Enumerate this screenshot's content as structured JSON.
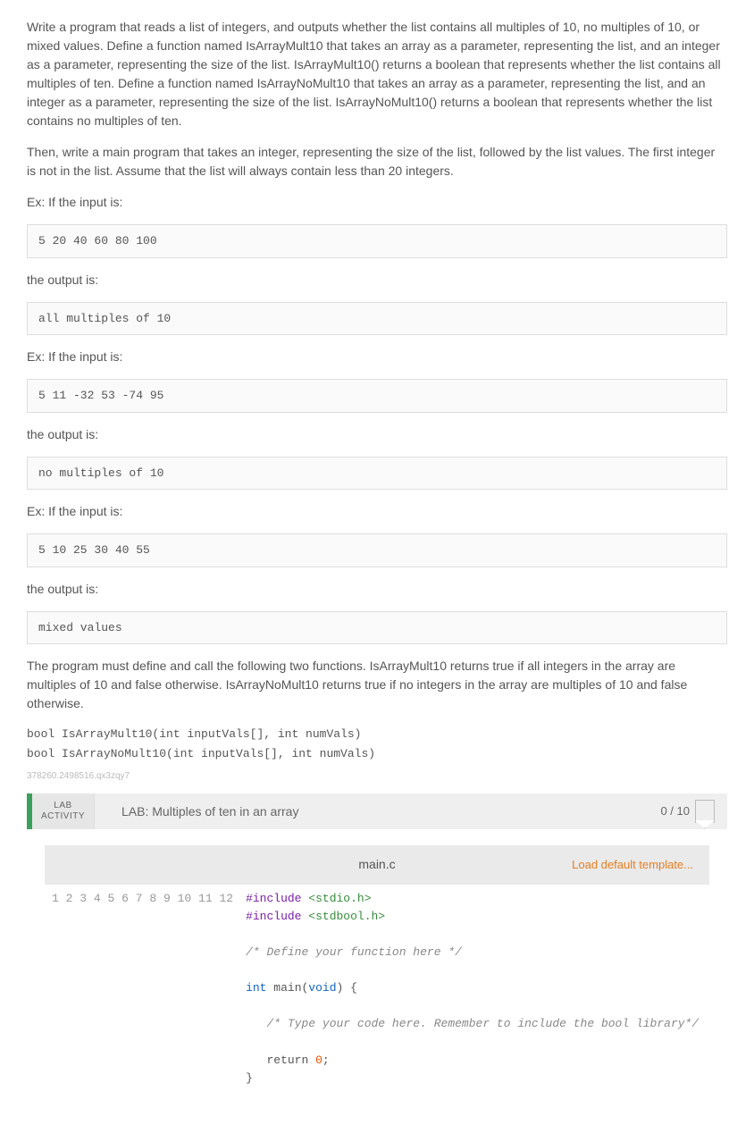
{
  "prose": {
    "p1": "Write a program that reads a list of integers, and outputs whether the list contains all multiples of 10, no multiples of 10, or mixed values. Define a function named IsArrayMult10 that takes an array as a parameter, representing the list, and an integer as a parameter, representing the size of the list. IsArrayMult10() returns a boolean that represents whether the list contains all multiples of ten. Define a function named IsArrayNoMult10 that takes an array as a parameter, representing the list, and an integer as a parameter, representing the size of the list. IsArrayNoMult10() returns a boolean that represents whether the list contains no multiples of ten.",
    "p2": "Then, write a main program that takes an integer, representing the size of the list, followed by the list values. The first integer is not in the list. Assume that the list will always contain less than 20 integers.",
    "ex_prefix_a": "Ex: If the input is:",
    "ex_prefix_b": "Ex: If the input is:",
    "ex_prefix_c": "Ex: If the input is:",
    "outlabel_a": "the output is:",
    "outlabel_b": "the output is:",
    "outlabel_c": "the output is:",
    "p3": "The program must define and call the following two functions. IsArrayMult10 returns true if all integers in the array are multiples of 10 and false otherwise. IsArrayNoMult10 returns true if no integers in the array are multiples of 10 and false otherwise.",
    "sig1": "bool IsArrayMult10(int inputVals[], int numVals)",
    "sig2": "bool IsArrayNoMult10(int inputVals[], int numVals)"
  },
  "examples": {
    "in1": "5 20 40 60 80 100",
    "out1": "all multiples of 10",
    "in2": "5 11 -32 53 -74 95",
    "out2": "no multiples of 10",
    "in3": "5 10 25 30 40 55",
    "out3": "mixed values"
  },
  "watermark": "378260.2498516.qx3zqy7",
  "lab": {
    "badge_line1": "LAB",
    "badge_line2": "ACTIVITY",
    "title": "LAB: Multiples of ten in an array",
    "score": "0 / 10"
  },
  "editor": {
    "filename": "main.c",
    "load_template": "Load default template...",
    "lines": [
      "1",
      "2",
      "3",
      "4",
      "5",
      "6",
      "7",
      "8",
      "9",
      "10",
      "11",
      "12"
    ],
    "code": {
      "l1_a": "#include ",
      "l1_b": "<stdio.h>",
      "l2_a": "#include ",
      "l2_b": "<stdbool.h>",
      "l4": "/* Define your function here */",
      "l6_a": "int",
      "l6_b": " main(",
      "l6_c": "void",
      "l6_d": ") {",
      "l8": "   /* Type your code here. Remember to include the bool library*/",
      "l10_a": "   return ",
      "l10_b": "0",
      "l10_c": ";",
      "l11": "}"
    }
  }
}
